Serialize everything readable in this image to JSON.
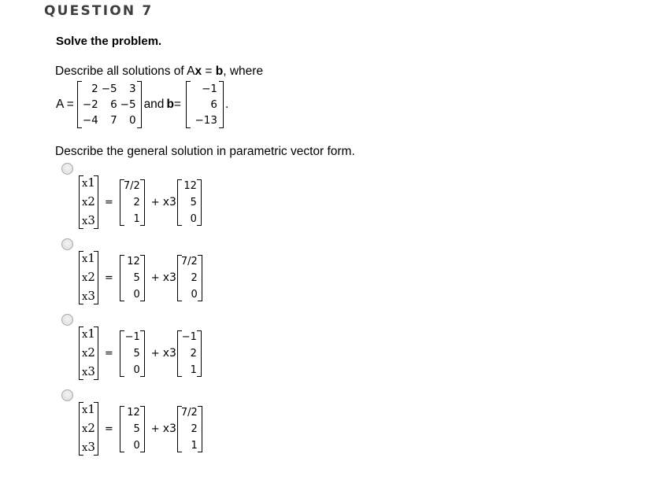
{
  "question": {
    "header": "QUESTION 7",
    "instruction": "Solve the problem.",
    "prompt": {
      "prefix": "Describe all solutions of A",
      "x": "x",
      "equals": " = ",
      "b": "b",
      "suffix": ", where"
    },
    "matrix_A": {
      "label": "A =",
      "rows": [
        [
          "2",
          "−5",
          "3"
        ],
        [
          "−2",
          "6",
          "−5"
        ],
        [
          "−4",
          "7",
          "0"
        ]
      ]
    },
    "and_label": "and",
    "vector_b": {
      "label": "b",
      "equals": " =",
      "values": [
        "−1",
        "6",
        "−13"
      ]
    },
    "period": ".",
    "general_prompt": "Describe the general solution in parametric vector form."
  },
  "options": [
    {
      "id": "A",
      "selected": false,
      "lhs": [
        "x1",
        "x2",
        "x3"
      ],
      "equals": "=",
      "constant": [
        "7/2",
        "2",
        "1"
      ],
      "plus": "+",
      "param": "x3",
      "direction": [
        "12",
        "5",
        "0"
      ]
    },
    {
      "id": "B",
      "selected": false,
      "lhs": [
        "x1",
        "x2",
        "x3"
      ],
      "equals": "=",
      "constant": [
        "12",
        "5",
        "0"
      ],
      "plus": "+",
      "param": "x3",
      "direction": [
        "7/2",
        "2",
        "0"
      ]
    },
    {
      "id": "C",
      "selected": false,
      "lhs": [
        "x1",
        "x2",
        "x3"
      ],
      "equals": "=",
      "constant": [
        "−1",
        "5",
        "0"
      ],
      "plus": "+",
      "param": "x3",
      "direction": [
        "−1",
        "2",
        "1"
      ]
    },
    {
      "id": "D",
      "selected": false,
      "lhs": [
        "x1",
        "x2",
        "x3"
      ],
      "equals": "=",
      "constant": [
        "12",
        "5",
        "0"
      ],
      "plus": "+",
      "param": "x3",
      "direction": [
        "7/2",
        "2",
        "1"
      ]
    }
  ],
  "colors": {
    "header_text": "#3d3d3d",
    "body_text": "#000000",
    "radio_border": "#a8a8a8",
    "radio_fill": "#e2e2e2"
  }
}
